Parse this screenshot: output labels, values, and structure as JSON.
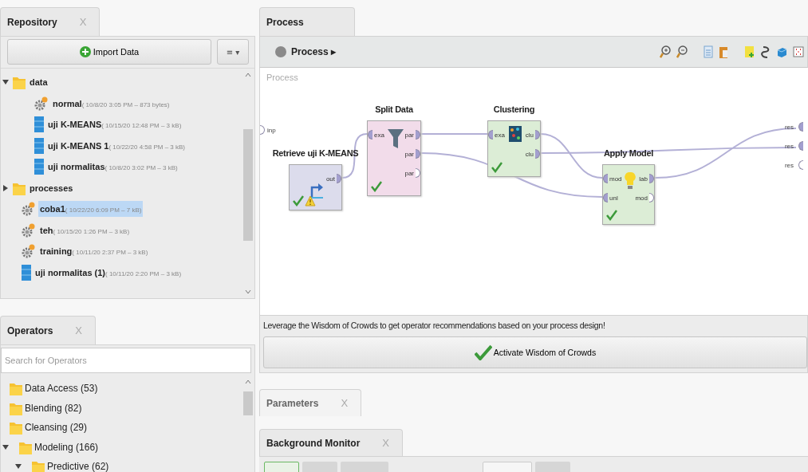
{
  "repository": {
    "tab": {
      "label": "Repository",
      "close": "X",
      "selected": true
    },
    "import_button": "Import Data",
    "menu_button": "≡ ▾",
    "tree": [
      {
        "name": "data",
        "kind": "folder",
        "expanded": true,
        "selected": false,
        "children": [
          {
            "name": "normal",
            "meta": "( 10/8/20 3:05 PM – 873 bytes)",
            "kind": "process",
            "selected": false
          },
          {
            "name": "uji K-MEANS",
            "meta": "( 10/15/20 12:48 PM – 3 kB)",
            "kind": "data",
            "selected": false
          },
          {
            "name": "uji K-MEANS 1",
            "meta": "( 10/22/20 4:58 PM – 3 kB)",
            "kind": "data",
            "selected": false
          },
          {
            "name": "uji normalitas",
            "meta": "( 10/8/20 3:02 PM – 3 kB)",
            "kind": "data",
            "selected": false
          }
        ]
      },
      {
        "name": "processes",
        "kind": "folder",
        "expanded": false,
        "selected": false
      },
      {
        "name": "coba1",
        "meta": "( 10/22/20 6:09 PM – 7 kB)",
        "kind": "process",
        "selected": true
      },
      {
        "name": "teh",
        "meta": "( 10/15/20 1:26 PM – 3 kB)",
        "kind": "process",
        "selected": false
      },
      {
        "name": "training",
        "meta": "( 10/11/20 2:37 PM – 3 kB)",
        "kind": "process",
        "selected": false
      },
      {
        "name": "uji normalitas (1)",
        "meta": "( 10/11/20 2:20 PM – 3 kB)",
        "kind": "data",
        "selected": false
      }
    ]
  },
  "operators": {
    "tab": {
      "label": "Operators",
      "close": "X",
      "selected": true
    },
    "search": {
      "placeholder": "Search for Operators"
    },
    "tree": [
      {
        "name": "Data Access (53)",
        "kind": "folder",
        "expanded": false
      },
      {
        "name": "Blending (82)",
        "kind": "folder",
        "expanded": false
      },
      {
        "name": "Cleansing (29)",
        "kind": "folder",
        "expanded": false
      },
      {
        "name": "Modeling (166)",
        "kind": "folder",
        "expanded": true,
        "children": [
          {
            "name": "Predictive (62)",
            "kind": "folder",
            "expanded": true
          }
        ]
      }
    ]
  },
  "process": {
    "tab": {
      "label": "Process",
      "selected": true
    },
    "breadcrumb": "Process ▸",
    "canvas_label": "Process",
    "inputs": [
      {
        "label": "inp",
        "connected": false
      }
    ],
    "outputs": [
      {
        "label": "res",
        "connected": true
      },
      {
        "label": "res",
        "connected": true
      },
      {
        "label": "res",
        "connected": false
      }
    ],
    "operators": [
      {
        "name": "Retrieve uji K-MEANS",
        "kind": "retrieve",
        "color": "#dcdcec",
        "done": true,
        "warning": true,
        "outputs": [
          {
            "label": "out",
            "connected": true
          }
        ]
      },
      {
        "name": "Split Data",
        "kind": "split",
        "color": "#f2dcea",
        "done": true,
        "warning": false,
        "inputs": [
          {
            "label": "exa",
            "connected": true
          }
        ],
        "outputs": [
          {
            "label": "par",
            "connected": true
          },
          {
            "label": "par",
            "connected": true
          },
          {
            "label": "par",
            "connected": false
          }
        ]
      },
      {
        "name": "Clustering",
        "kind": "cluster",
        "color": "#dcedd6",
        "done": true,
        "warning": false,
        "inputs": [
          {
            "label": "exa",
            "connected": true
          }
        ],
        "outputs": [
          {
            "label": "clu",
            "connected": true
          },
          {
            "label": "clu",
            "connected": true
          }
        ]
      },
      {
        "name": "Apply Model",
        "kind": "apply",
        "color": "#dcedd6",
        "done": true,
        "warning": false,
        "inputs": [
          {
            "label": "mod",
            "connected": true
          },
          {
            "label": "unl",
            "connected": true
          }
        ],
        "outputs": [
          {
            "label": "lab",
            "connected": true
          },
          {
            "label": "mod",
            "connected": false
          }
        ]
      }
    ]
  },
  "wisdom": {
    "text": "Leverage the Wisdom of Crowds to get operator recommendations based on your process design!",
    "button": "Activate Wisdom of Crowds"
  },
  "parameters": {
    "tab": {
      "label": "Parameters",
      "close": "X",
      "selected": false
    }
  },
  "monitor": {
    "tab": {
      "label": "Background Monitor",
      "close": "X",
      "selected": true
    }
  }
}
